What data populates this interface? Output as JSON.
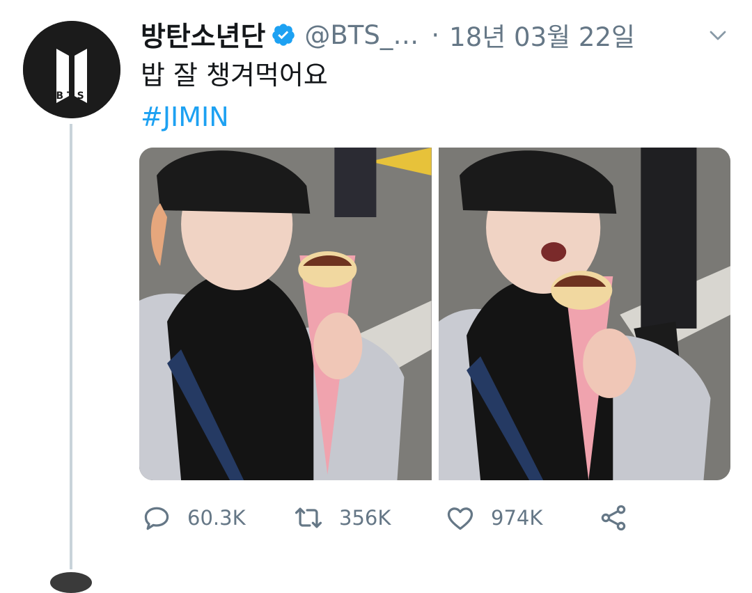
{
  "tweet": {
    "display_name": "방탄소년단",
    "handle": "@BTS_…",
    "separator": "·",
    "timestamp": "18년 03월 22일",
    "text": "밥 잘 챙겨먹어요",
    "hashtag": "#JIMIN",
    "avatar_logo_text": "BTS"
  },
  "actions": {
    "replies": "60.3K",
    "retweets": "356K",
    "likes": "974K"
  },
  "icons": {
    "verified": "verified-badge-icon",
    "caret": "chevron-down-icon",
    "reply": "reply-icon",
    "retweet": "retweet-icon",
    "like": "heart-icon",
    "share": "share-icon"
  },
  "colors": {
    "text_primary": "#14171a",
    "text_secondary": "#657786",
    "accent": "#1da1f2",
    "thread_line": "#c9d3da"
  },
  "media": {
    "photos": [
      {
        "description_icon": "photo-selfie-crepe-1"
      },
      {
        "description_icon": "photo-selfie-crepe-2"
      }
    ]
  }
}
